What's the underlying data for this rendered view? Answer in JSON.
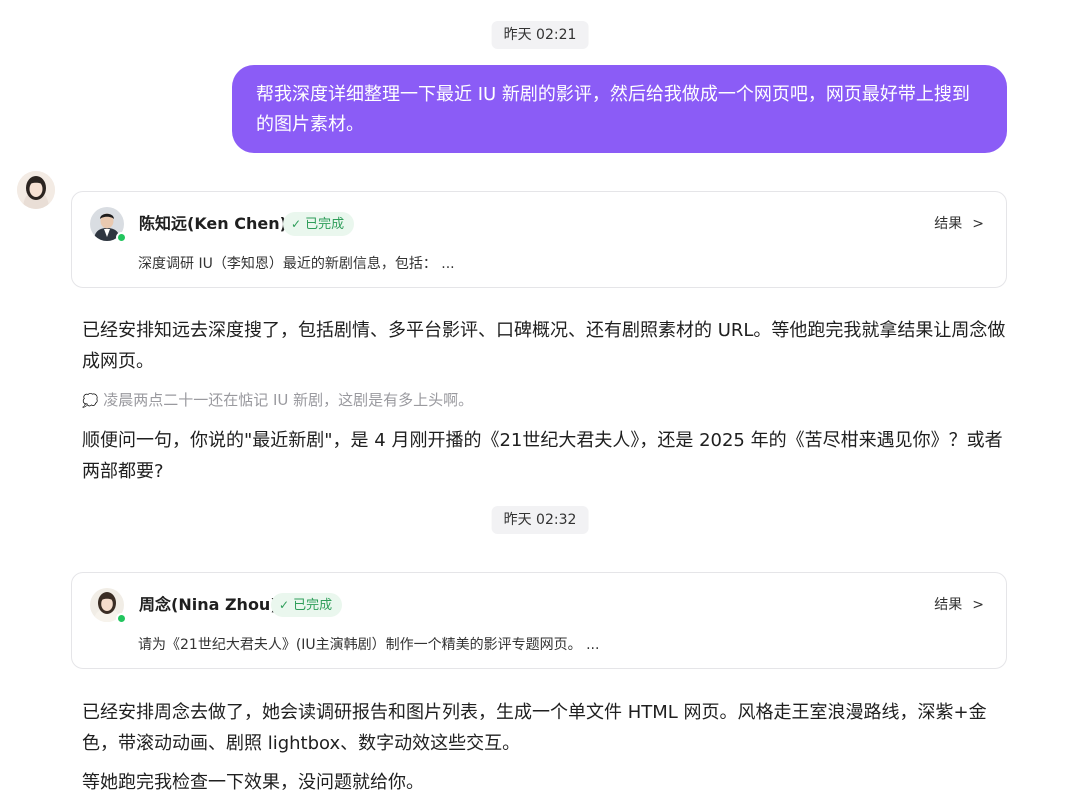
{
  "timestamps": [
    "昨天 02:21",
    "昨天 02:32"
  ],
  "user_message": "帮我深度详细整理一下最近 IU 新剧的影评，然后给我做成一个网页吧，网页最好带上搜到的图片素材。",
  "tasks": [
    {
      "agent_name": "陈知远(Ken Chen)",
      "status": "已完成",
      "result_label": "结果",
      "description": "深度调研 IU（李知恩）最近的新剧信息，包括：  ..."
    },
    {
      "agent_name": "周念(Nina Zhou)",
      "status": "已完成",
      "result_label": "结果",
      "description": "请为《21世纪大君夫人》(IU主演韩剧）制作一个精美的影评专题网页。 ..."
    }
  ],
  "assistant_messages": {
    "msg1": "已经安排知远去深度搜了，包括剧情、多平台影评、口碑概况、还有剧照素材的 URL。等他跑完我就拿结果让周念做成网页。",
    "thought": "凌晨两点二十一还在惦记 IU 新剧，这剧是有多上头啊。",
    "msg2": "顺便问一句，你说的\"最近新剧\"，是 4 月刚开播的《21世纪大君夫人》，还是 2025 年的《苦尽柑来遇见你》？或者两部都要?",
    "msg3": "已经安排周念去做了，她会读调研报告和图片列表，生成一个单文件 HTML 网页。风格走王室浪漫路线，深紫+金色，带滚动动画、剧照 lightbox、数字动效这些交互。",
    "msg4": "等她跑完我检查一下效果，没问题就给你。"
  },
  "colors": {
    "user_bubble": "#8b5cf6",
    "status_green": "#2f9e5a",
    "status_bg": "#eaf7ee",
    "online_dot": "#22c55e"
  },
  "icons": {
    "status": "check-icon",
    "result": "chevron-right-icon",
    "thought": "thought-bubble-icon",
    "online": "online-status-icon"
  }
}
